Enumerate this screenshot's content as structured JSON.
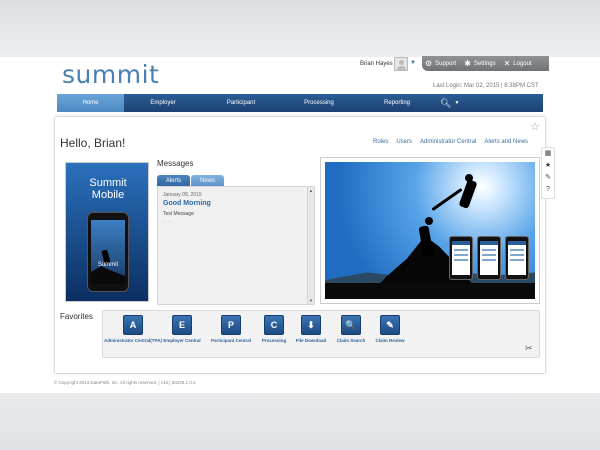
{
  "app": {
    "logo_text": "summit"
  },
  "header": {
    "user_name": "Brian Hayes",
    "util": {
      "support": "Support",
      "settings": "Settings",
      "logout": "Logout"
    },
    "last_login": "Last Login: Mar 02, 2015 | 8:38PM CST"
  },
  "nav": {
    "tabs": [
      "Home",
      "Employer",
      "Participant",
      "Processing",
      "Reporting"
    ],
    "active": "Home"
  },
  "main": {
    "greeting": "Hello, Brian!",
    "links": [
      "Roles",
      "Users",
      "Administrator Central",
      "Alerts and News"
    ],
    "promo_title_1": "Summit",
    "promo_title_2": "Mobile",
    "promo_phone_text": "Summit",
    "messages": {
      "label": "Messages",
      "tabs": [
        "Alerts",
        "News"
      ],
      "date": "January 08, 2015",
      "title": "Good Morning",
      "body": "Test Message",
      "more": "— —"
    }
  },
  "favorites": {
    "label": "Favorites",
    "items": [
      {
        "letter": "A",
        "label": "Administrator Central(TPA)"
      },
      {
        "letter": "E",
        "label": "Employer Central"
      },
      {
        "letter": "P",
        "label": "Participant Central"
      },
      {
        "letter": "C",
        "label": "Processing"
      },
      {
        "letter": "⬇",
        "label": "File Download"
      },
      {
        "letter": "🔍",
        "label": "Claim Search"
      },
      {
        "letter": "✎",
        "label": "Claim Review"
      }
    ]
  },
  "footer": {
    "copyright": "© Copyright 2014 DataPath, Inc. All rights reserved. | v15 | 50228.1.0.3"
  },
  "colors": {
    "nav": "#1d4272",
    "nav_active": "#4d87c1",
    "accent": "#2d6aa8",
    "utility_bar": "#7a7e81"
  }
}
